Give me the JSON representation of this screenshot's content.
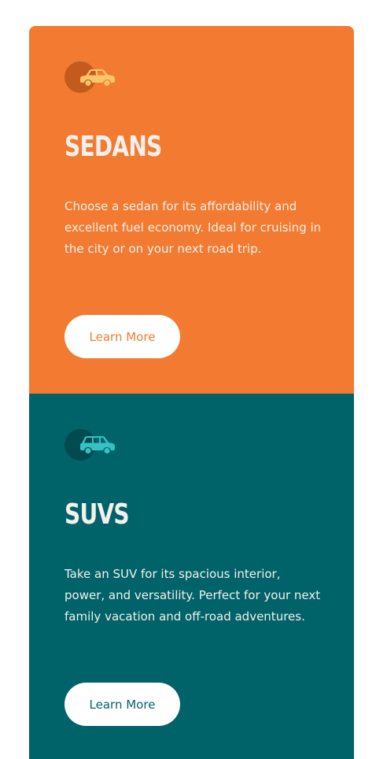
{
  "colors": {
    "sedans_bg": "#f27b31",
    "suvs_bg": "#00636a",
    "sedans_icon": "#ffc56b",
    "suvs_icon": "#36c2c2",
    "heading": "#f5f0ec",
    "button_bg": "#ffffff"
  },
  "cards": [
    {
      "icon": "sedan-car-icon",
      "title": "SEDANS",
      "text": "Choose a sedan for its affordability and excellent fuel economy. Ideal for cruising in the city or on your next road trip.",
      "button_label": "Learn More"
    },
    {
      "icon": "suv-car-icon",
      "title": "SUVS",
      "text": "Take an SUV for its spacious interior, power, and versatility. Perfect for your next family vacation and off-road adventures.",
      "button_label": "Learn More"
    }
  ]
}
